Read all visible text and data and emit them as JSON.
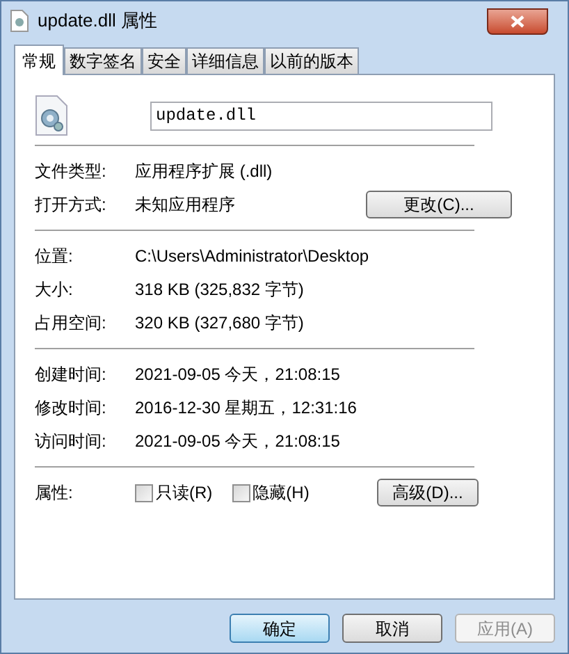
{
  "window": {
    "title": "update.dll 属性"
  },
  "tabs": [
    {
      "label": "常规",
      "selected": true
    },
    {
      "label": "数字签名",
      "selected": false
    },
    {
      "label": "安全",
      "selected": false
    },
    {
      "label": "详细信息",
      "selected": false
    },
    {
      "label": "以前的版本",
      "selected": false
    }
  ],
  "file_name": {
    "value": "update.dll"
  },
  "sections": [
    [
      {
        "label": "文件类型:",
        "value": "应用程序扩展 (.dll)"
      },
      {
        "label": "打开方式:",
        "value": "未知应用程序",
        "button": "更改(C)..."
      }
    ],
    [
      {
        "label": "位置:",
        "value": "C:\\Users\\Administrator\\Desktop"
      },
      {
        "label": "大小:",
        "value": "318 KB (325,832 字节)"
      },
      {
        "label": "占用空间:",
        "value": "320 KB (327,680 字节)"
      }
    ],
    [
      {
        "label": "创建时间:",
        "value": "2021-09-05 今天，21:08:15"
      },
      {
        "label": "修改时间:",
        "value": "2016-12-30 星期五，12:31:16"
      },
      {
        "label": "访问时间:",
        "value": "2021-09-05 今天，21:08:15"
      }
    ]
  ],
  "attributes": {
    "label": "属性:",
    "checkboxes": [
      {
        "label": "只读(R)",
        "checked": false
      },
      {
        "label": "隐藏(H)",
        "checked": false
      }
    ],
    "button": "高级(D)..."
  },
  "buttons": [
    {
      "label": "确定",
      "default": true,
      "disabled": false
    },
    {
      "label": "取消",
      "default": false,
      "disabled": false
    },
    {
      "label": "应用(A)",
      "default": false,
      "disabled": true
    }
  ]
}
